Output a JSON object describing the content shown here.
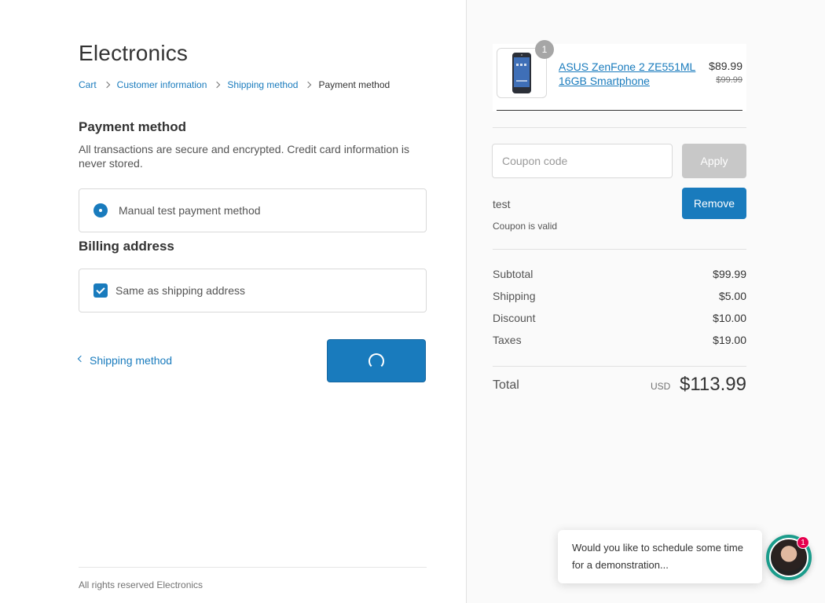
{
  "shop": {
    "title": "Electronics"
  },
  "breadcrumb": [
    {
      "label": "Cart"
    },
    {
      "label": "Customer information"
    },
    {
      "label": "Shipping method"
    },
    {
      "label": "Payment method"
    }
  ],
  "payment": {
    "title": "Payment method",
    "description": "All transactions are secure and encrypted. Credit card information is never stored.",
    "option_label": "Manual test payment method"
  },
  "billing": {
    "title": "Billing address",
    "same_as_shipping_label": "Same as shipping address"
  },
  "nav": {
    "back_label": "Shipping method",
    "pay_button_state": "loading"
  },
  "footer": {
    "text": "All rights reserved Electronics"
  },
  "order": {
    "product": {
      "name": "ASUS ZenFone 2 ZE551ML 16GB Smartphone",
      "quantity": "1",
      "price": "$89.99",
      "original_price": "$99.99"
    },
    "coupon": {
      "placeholder": "Coupon code",
      "apply_label": "Apply",
      "applied_code": "test",
      "status": "Coupon is valid",
      "remove_label": "Remove"
    },
    "summary": [
      {
        "label": "Subtotal",
        "value": "$99.99"
      },
      {
        "label": "Shipping",
        "value": "$5.00"
      },
      {
        "label": "Discount",
        "value": "$10.00"
      },
      {
        "label": "Taxes",
        "value": "$19.00"
      }
    ],
    "total": {
      "label": "Total",
      "currency": "USD",
      "value": "$113.99"
    }
  },
  "chat": {
    "message": "Would you like to schedule some time for a demonstration...",
    "unread_count": "1"
  },
  "colors": {
    "accent": "#197bbd",
    "disabled_button": "#c8c8c8",
    "sidebar_bg": "#fafafa",
    "chat_badge": "#e5004e"
  }
}
